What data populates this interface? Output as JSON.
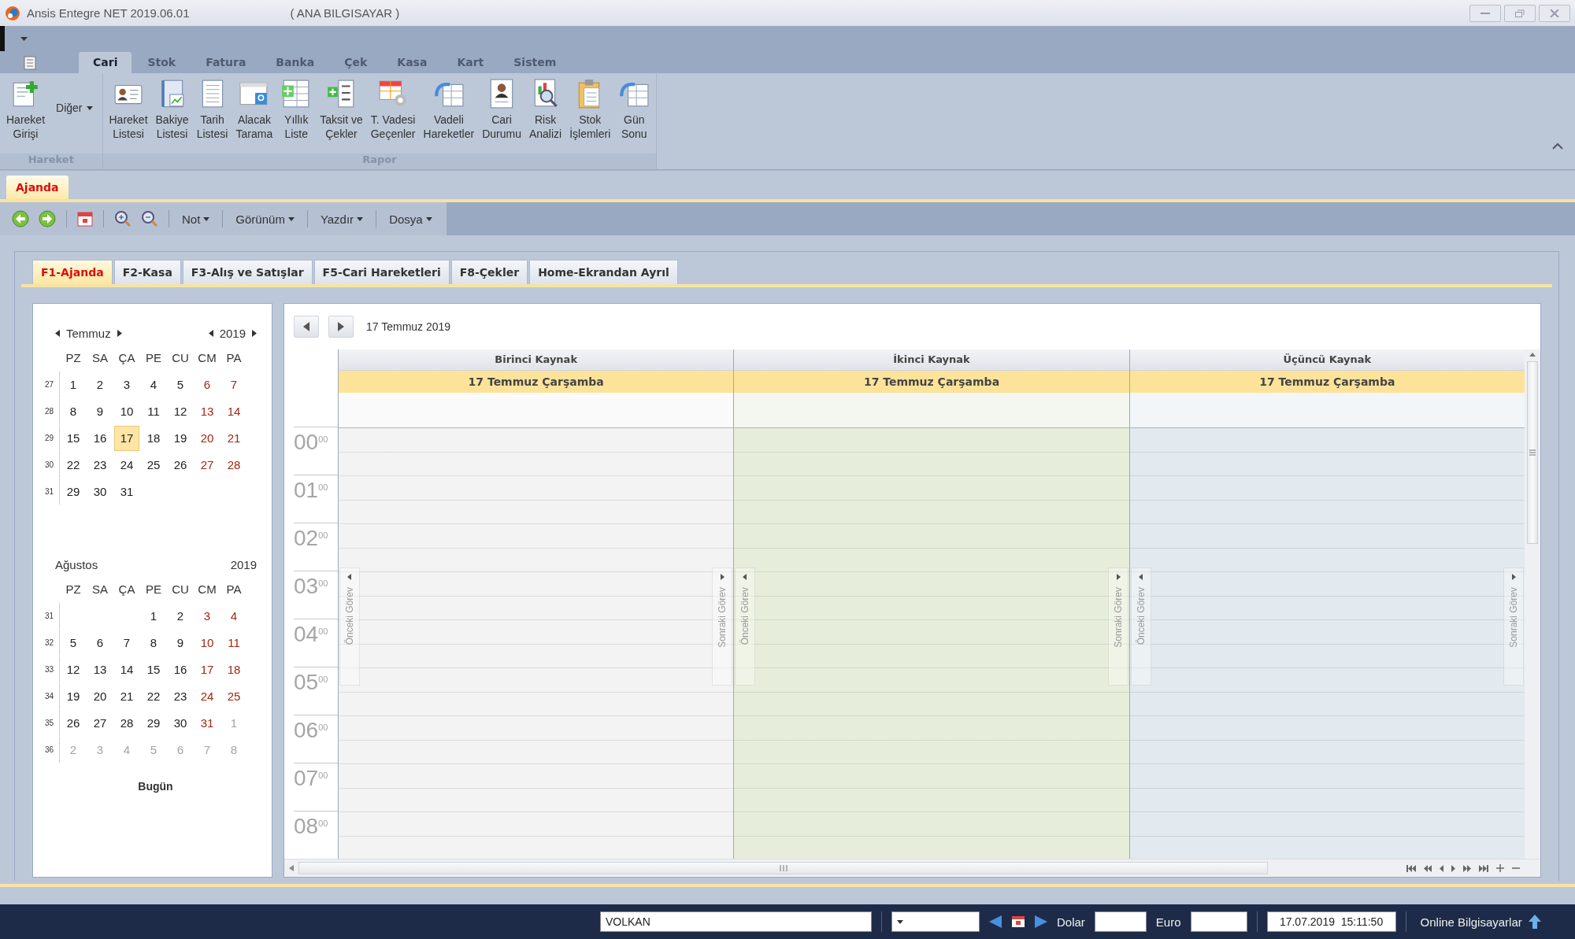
{
  "window": {
    "title": "Ansis Entegre NET 2019.06.01",
    "title_suffix": "( ANA BILGISAYAR )"
  },
  "ribbon": {
    "tabs": [
      {
        "label": "Cari",
        "selected": true
      },
      {
        "label": "Stok",
        "selected": false
      },
      {
        "label": "Fatura",
        "selected": false
      },
      {
        "label": "Banka",
        "selected": false
      },
      {
        "label": "Çek",
        "selected": false
      },
      {
        "label": "Kasa",
        "selected": false
      },
      {
        "label": "Kart",
        "selected": false
      },
      {
        "label": "Sistem",
        "selected": false
      }
    ],
    "groups": [
      {
        "label": "Hareket",
        "buttons": [
          {
            "label": "Hareket\nGirişi",
            "kind": "large"
          },
          {
            "label": "Diğer",
            "kind": "dropdown"
          }
        ]
      },
      {
        "label": "Rapor",
        "buttons": [
          {
            "label": "Hareket\nListesi",
            "kind": "large"
          },
          {
            "label": "Bakiye\nListesi",
            "kind": "large"
          },
          {
            "label": "Tarih\nListesi",
            "kind": "large"
          },
          {
            "label": "Alacak\nTarama",
            "kind": "large"
          },
          {
            "label": "Yıllık\nListe",
            "kind": "large"
          },
          {
            "label": "Taksit ve\nÇekler",
            "kind": "large"
          },
          {
            "label": "T. Vadesi\nGeçenler",
            "kind": "large"
          },
          {
            "label": "Vadeli\nHareketler",
            "kind": "large"
          },
          {
            "label": "Cari\nDurumu",
            "kind": "large"
          },
          {
            "label": "Risk\nAnalizi",
            "kind": "large"
          },
          {
            "label": "Stok\nİşlemleri",
            "kind": "large"
          },
          {
            "label": "Gün\nSonu",
            "kind": "large"
          }
        ]
      }
    ]
  },
  "document_tabs": [
    {
      "label": "Ajanda",
      "selected": true
    }
  ],
  "toolbar": {
    "menus": [
      "Not",
      "Görünüm",
      "Yazdır",
      "Dosya"
    ]
  },
  "agenda_tabs": [
    {
      "label": "F1-Ajanda",
      "selected": true
    },
    {
      "label": "F2-Kasa",
      "selected": false
    },
    {
      "label": "F3-Alış ve Satışlar",
      "selected": false
    },
    {
      "label": "F5-Cari Hareketleri",
      "selected": false
    },
    {
      "label": "F8-Çekler",
      "selected": false
    },
    {
      "label": "Home-Ekrandan Ayrıl",
      "selected": false
    }
  ],
  "calendar": {
    "months": [
      {
        "month": "Temmuz",
        "year": "2019",
        "nav": true,
        "weekdays": [
          "PZ",
          "SA",
          "ÇA",
          "PE",
          "CU",
          "CM",
          "PA"
        ],
        "weeks": [
          {
            "week": "27",
            "days": [
              {
                "day": "1",
                "kind": "weekday",
                "selected": false
              },
              {
                "day": "2",
                "kind": "weekday",
                "selected": false
              },
              {
                "day": "3",
                "kind": "weekday",
                "selected": false
              },
              {
                "day": "4",
                "kind": "weekday",
                "selected": false
              },
              {
                "day": "5",
                "kind": "weekday",
                "selected": false
              },
              {
                "day": "6",
                "kind": "weekend",
                "selected": false
              },
              {
                "day": "7",
                "kind": "weekend",
                "selected": false
              }
            ]
          },
          {
            "week": "28",
            "days": [
              {
                "day": "8",
                "kind": "weekday",
                "selected": false
              },
              {
                "day": "9",
                "kind": "weekday",
                "selected": false
              },
              {
                "day": "10",
                "kind": "weekday",
                "selected": false
              },
              {
                "day": "11",
                "kind": "weekday",
                "selected": false
              },
              {
                "day": "12",
                "kind": "weekday",
                "selected": false
              },
              {
                "day": "13",
                "kind": "weekend",
                "selected": false
              },
              {
                "day": "14",
                "kind": "weekend",
                "selected": false
              }
            ]
          },
          {
            "week": "29",
            "days": [
              {
                "day": "15",
                "kind": "weekday",
                "selected": false
              },
              {
                "day": "16",
                "kind": "weekday",
                "selected": false
              },
              {
                "day": "17",
                "kind": "weekday",
                "selected": true
              },
              {
                "day": "18",
                "kind": "weekday",
                "selected": false
              },
              {
                "day": "19",
                "kind": "weekday",
                "selected": false
              },
              {
                "day": "20",
                "kind": "weekend",
                "selected": false
              },
              {
                "day": "21",
                "kind": "weekend",
                "selected": false
              }
            ]
          },
          {
            "week": "30",
            "days": [
              {
                "day": "22",
                "kind": "weekday",
                "selected": false
              },
              {
                "day": "23",
                "kind": "weekday",
                "selected": false
              },
              {
                "day": "24",
                "kind": "weekday",
                "selected": false
              },
              {
                "day": "25",
                "kind": "weekday",
                "selected": false
              },
              {
                "day": "26",
                "kind": "weekday",
                "selected": false
              },
              {
                "day": "27",
                "kind": "weekend",
                "selected": false
              },
              {
                "day": "28",
                "kind": "weekend",
                "selected": false
              }
            ]
          },
          {
            "week": "31",
            "days": [
              {
                "day": "29",
                "kind": "weekday",
                "selected": false
              },
              {
                "day": "30",
                "kind": "weekday",
                "selected": false
              },
              {
                "day": "31",
                "kind": "weekday",
                "selected": false
              }
            ]
          }
        ]
      },
      {
        "month": "Ağustos",
        "year": "2019",
        "nav": false,
        "weekdays": [
          "PZ",
          "SA",
          "ÇA",
          "PE",
          "CU",
          "CM",
          "PA"
        ],
        "weeks": [
          {
            "week": "31",
            "days": [
              {
                "kind": "blank"
              },
              {
                "kind": "blank"
              },
              {
                "kind": "blank"
              },
              {
                "day": "1",
                "kind": "weekday",
                "selected": false
              },
              {
                "day": "2",
                "kind": "weekday",
                "selected": false
              },
              {
                "day": "3",
                "kind": "weekend",
                "selected": false
              },
              {
                "day": "4",
                "kind": "weekend",
                "selected": false
              }
            ]
          },
          {
            "week": "32",
            "days": [
              {
                "day": "5",
                "kind": "weekday",
                "selected": false
              },
              {
                "day": "6",
                "kind": "weekday",
                "selected": false
              },
              {
                "day": "7",
                "kind": "weekday",
                "selected": false
              },
              {
                "day": "8",
                "kind": "weekday",
                "selected": false
              },
              {
                "day": "9",
                "kind": "weekday",
                "selected": false
              },
              {
                "day": "10",
                "kind": "weekend",
                "selected": false
              },
              {
                "day": "11",
                "kind": "weekend",
                "selected": false
              }
            ]
          },
          {
            "week": "33",
            "days": [
              {
                "day": "12",
                "kind": "weekday",
                "selected": false
              },
              {
                "day": "13",
                "kind": "weekday",
                "selected": false
              },
              {
                "day": "14",
                "kind": "weekday",
                "selected": false
              },
              {
                "day": "15",
                "kind": "weekday",
                "selected": false
              },
              {
                "day": "16",
                "kind": "weekday",
                "selected": false
              },
              {
                "day": "17",
                "kind": "weekend",
                "selected": false
              },
              {
                "day": "18",
                "kind": "weekend",
                "selected": false
              }
            ]
          },
          {
            "week": "34",
            "days": [
              {
                "day": "19",
                "kind": "weekday",
                "selected": false
              },
              {
                "day": "20",
                "kind": "weekday",
                "selected": false
              },
              {
                "day": "21",
                "kind": "weekday",
                "selected": false
              },
              {
                "day": "22",
                "kind": "weekday",
                "selected": false
              },
              {
                "day": "23",
                "kind": "weekday",
                "selected": false
              },
              {
                "day": "24",
                "kind": "weekend",
                "selected": false
              },
              {
                "day": "25",
                "kind": "weekend",
                "selected": false
              }
            ]
          },
          {
            "week": "35",
            "days": [
              {
                "day": "26",
                "kind": "weekday",
                "selected": false
              },
              {
                "day": "27",
                "kind": "weekday",
                "selected": false
              },
              {
                "day": "28",
                "kind": "weekday",
                "selected": false
              },
              {
                "day": "29",
                "kind": "weekday",
                "selected": false
              },
              {
                "day": "30",
                "kind": "weekday",
                "selected": false
              },
              {
                "day": "31",
                "kind": "weekend",
                "selected": false
              },
              {
                "day": "1",
                "kind": "adjacent",
                "selected": false
              }
            ]
          },
          {
            "week": "36",
            "days": [
              {
                "day": "2",
                "kind": "adjacent",
                "selected": false
              },
              {
                "day": "3",
                "kind": "adjacent",
                "selected": false
              },
              {
                "day": "4",
                "kind": "adjacent",
                "selected": false
              },
              {
                "day": "5",
                "kind": "adjacent",
                "selected": false
              },
              {
                "day": "6",
                "kind": "adjacent",
                "selected": false
              },
              {
                "day": "7",
                "kind": "adjacent",
                "selected": false
              },
              {
                "day": "8",
                "kind": "adjacent",
                "selected": false
              }
            ]
          }
        ]
      }
    ],
    "today_button": "Bugün"
  },
  "scheduler": {
    "date_label": "17 Temmuz 2019",
    "resources": [
      {
        "name": "Birinci Kaynak",
        "date": "17 Temmuz Çarşamba",
        "color": "#f3f3f3",
        "prev_label": "Önceki Görev",
        "next_label": "Sonraki Görev"
      },
      {
        "name": "İkinci Kaynak",
        "date": "17 Temmuz Çarşamba",
        "color": "#e6eedb",
        "prev_label": "Önceki Görev",
        "next_label": "Sonraki Görev"
      },
      {
        "name": "Üçüncü Kaynak",
        "date": "17 Temmuz Çarşamba",
        "color": "#e2eaef",
        "prev_label": "Önceki Görev",
        "next_label": "Sonraki Görev"
      }
    ],
    "hours": [
      "00$^{00}$",
      "01$^{00}$",
      "02$^{00}$",
      "03$^{00}$",
      "04$^{00}$",
      "05$^{00}$",
      "06$^{00}$",
      "07$^{00}$",
      "08$^{00}$"
    ]
  },
  "status_bar": {
    "user": "VOLKAN",
    "dollar_label": "Dolar",
    "euro_label": "Euro",
    "datetime": "17.07.2019  15:11:50",
    "online_label": "Online Bilgisayarlar"
  }
}
